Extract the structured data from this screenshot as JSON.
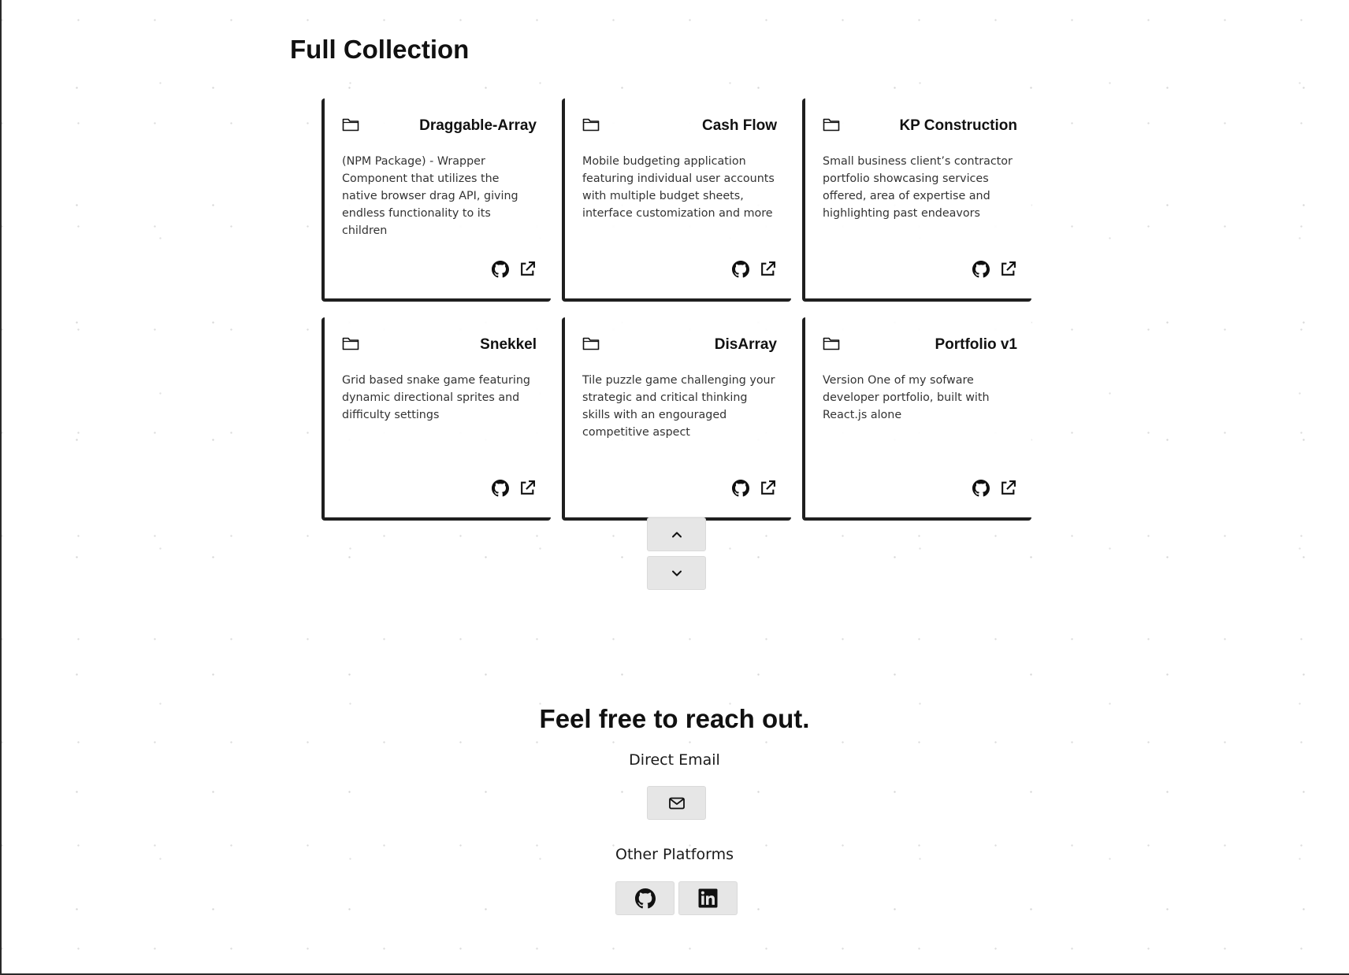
{
  "collection": {
    "title": "Full Collection",
    "projects": [
      {
        "title": "Draggable-Array",
        "description": "(NPM Package) - Wrapper Component that utilizes the native browser drag API, giving endless functionality to its children"
      },
      {
        "title": "Cash Flow",
        "description": "Mobile budgeting application featuring individual user accounts with multiple budget sheets, interface customization and more"
      },
      {
        "title": "KP Construction",
        "description": "Small business client’s contractor portfolio showcasing services offered, area of expertise and highlighting past endeavors"
      },
      {
        "title": "Snekkel",
        "description": "Grid based snake game featuring dynamic directional sprites and difficulty settings"
      },
      {
        "title": "DisArray",
        "description": "Tile puzzle game challenging your strategic and critical thinking skills with an engouraged competitive aspect"
      },
      {
        "title": "Portfolio v1",
        "description": "Version One of my sofware developer portfolio, built with React.js alone"
      }
    ],
    "card_icons": [
      "folder-icon",
      "github-icon",
      "external-link-icon"
    ],
    "pager_icons": [
      "chevron-up-icon",
      "chevron-down-icon"
    ]
  },
  "contact": {
    "title": "Feel free to reach out.",
    "email_label": "Direct Email",
    "email_icon": "mail-icon",
    "platforms_label": "Other Platforms",
    "platform_icons": [
      "github-icon",
      "linkedin-icon"
    ]
  },
  "colors": {
    "text": "#111111",
    "card_border": "#1f1f1f",
    "button_bg": "#e6e6e6",
    "description_text": "#333333"
  }
}
